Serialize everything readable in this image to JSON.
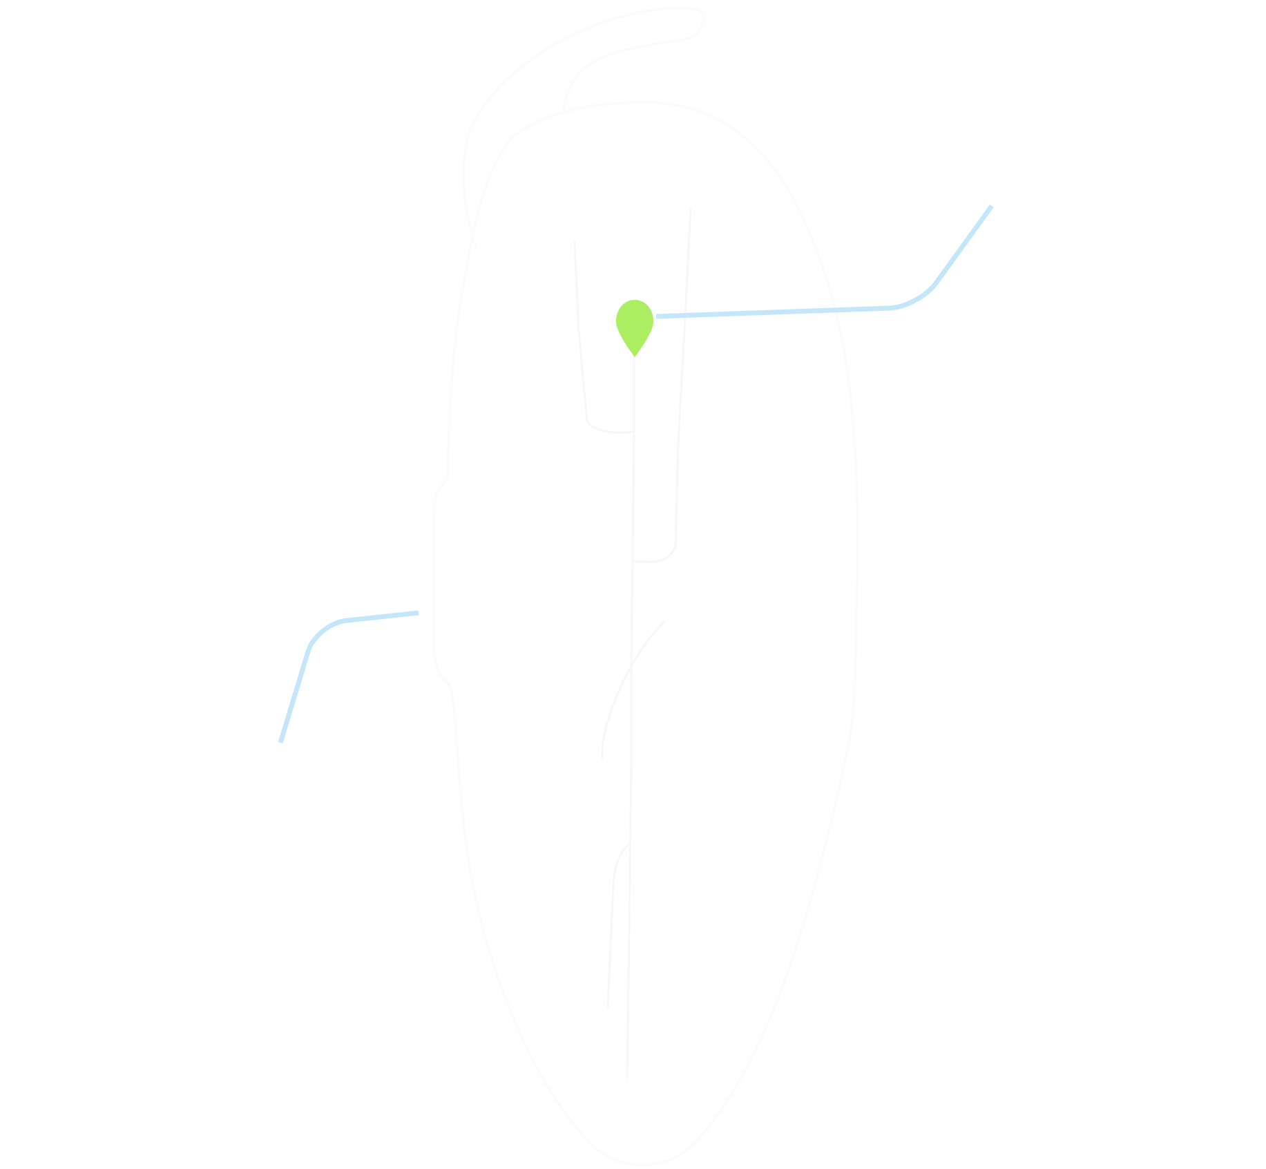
{
  "map": {
    "colors": {
      "background": "#ffffff",
      "land_outline": "#fbfbf9",
      "route": "#c3e6fb",
      "marker": "#abee62"
    },
    "icons": {
      "marker": "map-pin-icon"
    }
  }
}
